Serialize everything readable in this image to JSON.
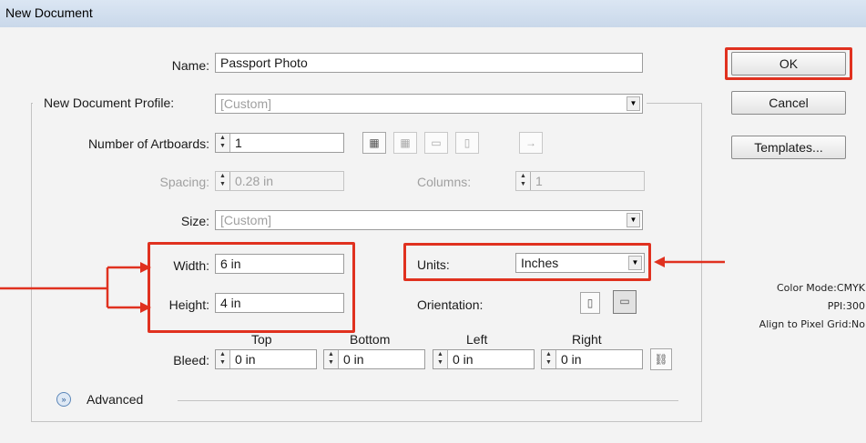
{
  "window": {
    "title": "New Document"
  },
  "name": {
    "label": "Name:",
    "value": "Passport Photo"
  },
  "profile": {
    "label": "New Document Profile:",
    "value": "[Custom]"
  },
  "artboards": {
    "label": "Number of Artboards:",
    "value": "1",
    "spacing_label": "Spacing:",
    "spacing_value": "0.28 in",
    "columns_label": "Columns:",
    "columns_value": "1"
  },
  "size": {
    "label": "Size:",
    "value": "[Custom]"
  },
  "width": {
    "label": "Width:",
    "value": "6 in"
  },
  "height": {
    "label": "Height:",
    "value": "4 in"
  },
  "units": {
    "label": "Units:",
    "value": "Inches"
  },
  "orientation": {
    "label": "Orientation:"
  },
  "bleed": {
    "label": "Bleed:",
    "top_label": "Top",
    "bottom_label": "Bottom",
    "left_label": "Left",
    "right_label": "Right",
    "top": "0 in",
    "bottom": "0 in",
    "left": "0 in",
    "right": "0 in"
  },
  "advanced": {
    "label": "Advanced"
  },
  "buttons": {
    "ok": "OK",
    "cancel": "Cancel",
    "templates": "Templates..."
  },
  "info": {
    "color_mode": "Color Mode:CMYK",
    "ppi": "PPI:300",
    "align": "Align to Pixel Grid:No"
  },
  "annotation_color": "#e0311f"
}
